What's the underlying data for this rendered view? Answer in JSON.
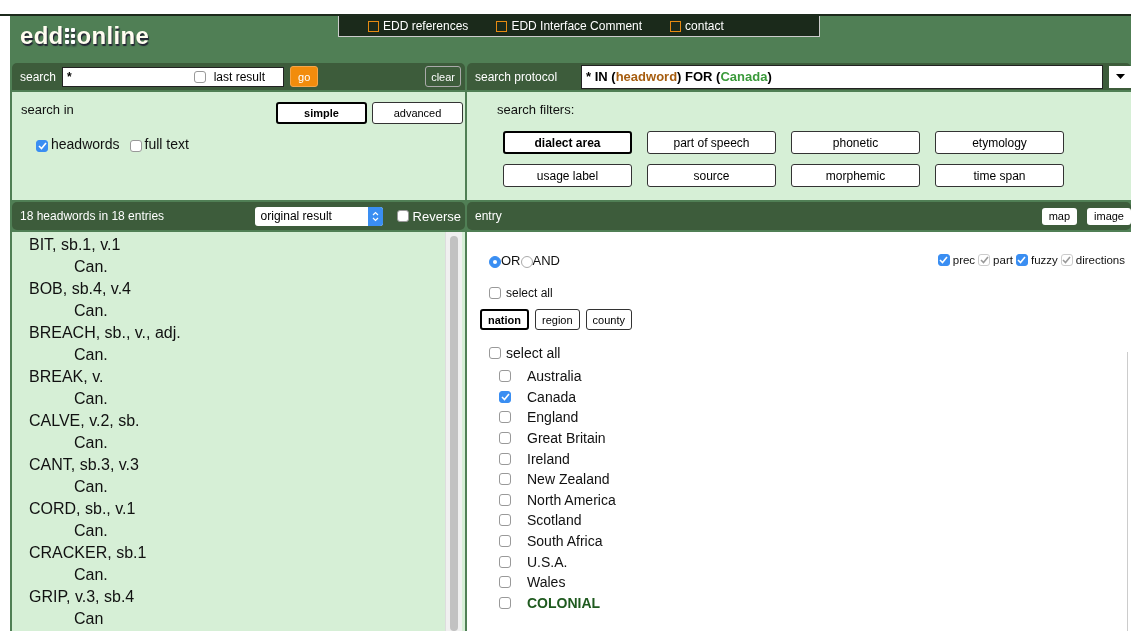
{
  "logo": {
    "left": "edd",
    "right": "online"
  },
  "nav": [
    {
      "label": "EDD references"
    },
    {
      "label": "EDD Interface Comment"
    },
    {
      "label": "contact"
    }
  ],
  "search": {
    "label": "search",
    "value": "*",
    "last_result": {
      "label": "last result",
      "checked": false
    },
    "go": "go",
    "clear": "clear"
  },
  "search_in": {
    "label": "search in",
    "modes": [
      {
        "label": "simple",
        "selected": true
      },
      {
        "label": "advanced",
        "selected": false
      }
    ],
    "fields": [
      {
        "label": "headwords",
        "checked": true
      },
      {
        "label": "full text",
        "checked": false
      }
    ]
  },
  "protocol": {
    "label": "search protocol",
    "segments": [
      {
        "text": "* IN (",
        "kind": "plain"
      },
      {
        "text": "headword",
        "kind": "field"
      },
      {
        "text": ") FOR (",
        "kind": "plain"
      },
      {
        "text": "Canada",
        "kind": "value"
      },
      {
        "text": ")",
        "kind": "plain"
      }
    ]
  },
  "filters": {
    "label": "search filters:",
    "buttons": [
      {
        "label": "dialect area",
        "selected": true
      },
      {
        "label": "part of speech",
        "selected": false
      },
      {
        "label": "phonetic",
        "selected": false
      },
      {
        "label": "etymology",
        "selected": false
      },
      {
        "label": "usage label",
        "selected": false
      },
      {
        "label": "source",
        "selected": false
      },
      {
        "label": "morphemic",
        "selected": false
      },
      {
        "label": "time span",
        "selected": false
      }
    ]
  },
  "results": {
    "count": "18 headwords in 18 entries",
    "sort": "original result",
    "reverse": {
      "label": "Reverse",
      "checked": false
    },
    "entries": [
      {
        "headword": "BIT, sb.1, v.1",
        "locations": [
          "Can."
        ]
      },
      {
        "headword": "BOB, sb.4, v.4",
        "locations": [
          "Can."
        ]
      },
      {
        "headword": "BREACH, sb., v., adj.",
        "locations": [
          "Can."
        ]
      },
      {
        "headword": "BREAK, v.",
        "locations": [
          "Can."
        ]
      },
      {
        "headword": "CALVE, v.2, sb.",
        "locations": [
          "Can."
        ]
      },
      {
        "headword": "CANT, sb.3, v.3",
        "locations": [
          "Can."
        ]
      },
      {
        "headword": "CORD, sb., v.1",
        "locations": [
          "Can."
        ]
      },
      {
        "headword": "CRACKER, sb.1",
        "locations": [
          "Can."
        ]
      },
      {
        "headword": "GRIP, v.3, sb.4",
        "locations": [
          "Can"
        ]
      }
    ]
  },
  "entry": {
    "label": "entry",
    "buttons": [
      "map",
      "image"
    ],
    "logic": [
      {
        "label": "OR",
        "selected": true
      },
      {
        "label": "AND",
        "selected": false
      }
    ],
    "options": [
      {
        "label": "prec",
        "checked": true,
        "disabled": false
      },
      {
        "label": "part",
        "checked": true,
        "disabled": true
      },
      {
        "label": "fuzzy",
        "checked": true,
        "disabled": false
      },
      {
        "label": "directions",
        "checked": true,
        "disabled": true
      }
    ],
    "select_all_top": {
      "label": "select all",
      "checked": false
    },
    "levels": [
      {
        "label": "nation",
        "selected": true
      },
      {
        "label": "region",
        "selected": false
      },
      {
        "label": "county",
        "selected": false
      }
    ],
    "select_all": {
      "label": "select all",
      "checked": false
    },
    "places": [
      {
        "label": "Australia",
        "checked": false,
        "kind": "place"
      },
      {
        "label": "Canada",
        "checked": true,
        "kind": "place"
      },
      {
        "label": "England",
        "checked": false,
        "kind": "place"
      },
      {
        "label": "Great Britain",
        "checked": false,
        "kind": "place"
      },
      {
        "label": "Ireland",
        "checked": false,
        "kind": "place"
      },
      {
        "label": "New Zealand",
        "checked": false,
        "kind": "place"
      },
      {
        "label": "North America",
        "checked": false,
        "kind": "place"
      },
      {
        "label": "Scotland",
        "checked": false,
        "kind": "place"
      },
      {
        "label": "South Africa",
        "checked": false,
        "kind": "place"
      },
      {
        "label": "U.S.A.",
        "checked": false,
        "kind": "place"
      },
      {
        "label": "Wales",
        "checked": false,
        "kind": "place"
      },
      {
        "label": "COLONIAL",
        "checked": false,
        "kind": "group"
      }
    ]
  }
}
